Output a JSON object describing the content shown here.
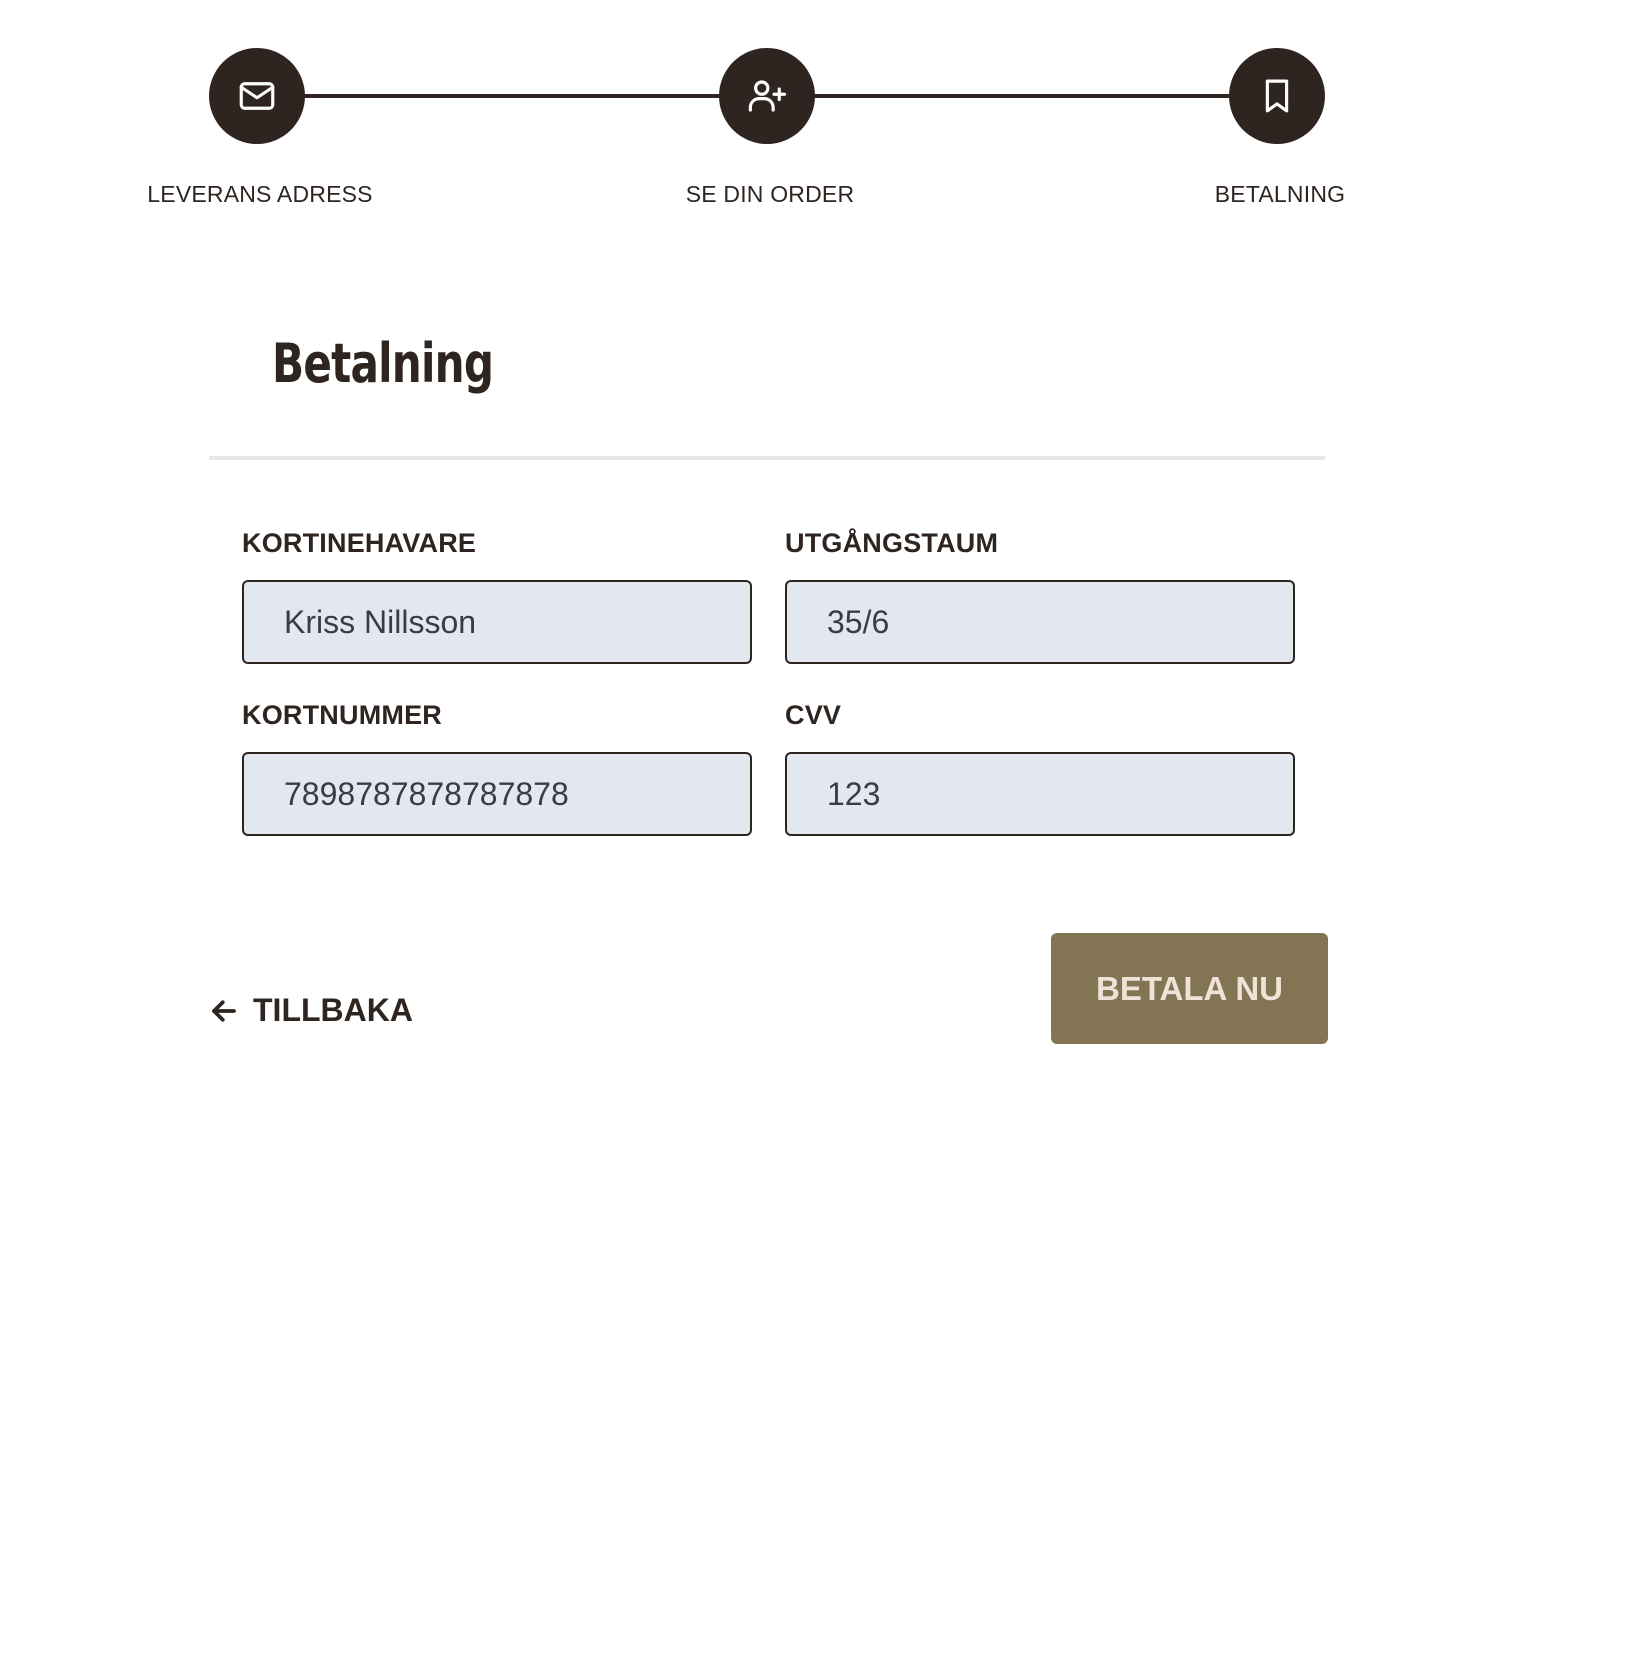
{
  "stepper": {
    "steps": [
      {
        "label": "LEVERANS ADRESS",
        "icon": "mail-icon"
      },
      {
        "label": "SE DIN ORDER",
        "icon": "user-plus-icon"
      },
      {
        "label": "BETALNING",
        "icon": "bookmark-icon"
      }
    ]
  },
  "page": {
    "title": "Betalning"
  },
  "form": {
    "cardholder": {
      "label": "KORTINEHAVARE",
      "value": "Kriss Nillsson"
    },
    "expiry": {
      "label": "UTGÅNGSTAUM",
      "value": "35/6"
    },
    "card_number": {
      "label": "KORTNUMMER",
      "value": "7898787878787878"
    },
    "cvv": {
      "label": "CVV",
      "value": "123"
    }
  },
  "actions": {
    "back_label": "TILLBAKA",
    "pay_label": "BETALA NU"
  },
  "colors": {
    "primary_dark": "#2e2520",
    "accent": "#837453",
    "input_bg": "#e3e8f0"
  }
}
